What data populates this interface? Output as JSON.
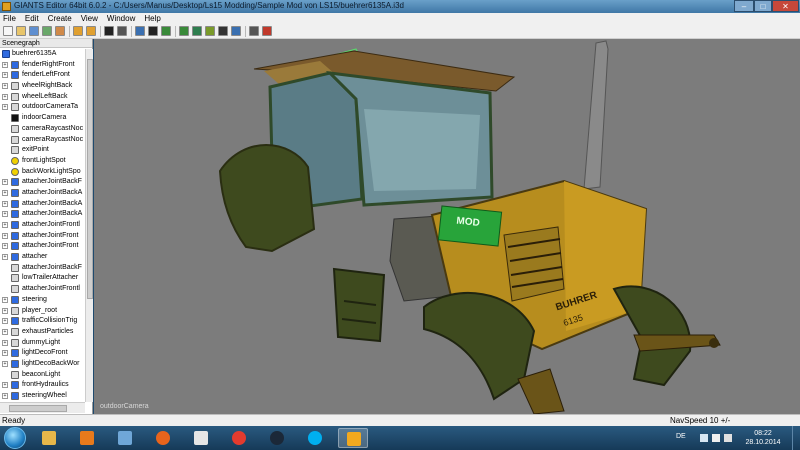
{
  "window": {
    "title": "GIANTS Editor 64bit 6.0.2 - C:/Users/Manus/Desktop/Ls15 Modding/Sample Mod von LS15/buehrer6135A.i3d",
    "minimize": "–",
    "maximize": "□",
    "close": "✕"
  },
  "menu": [
    "File",
    "Edit",
    "Create",
    "View",
    "Window",
    "Help"
  ],
  "toolbar": {
    "icons": [
      "new-icon",
      "open-icon",
      "save-icon",
      "import-icon",
      "export-icon",
      "undo-icon",
      "redo-icon",
      "play-icon",
      "stop-icon",
      "select-icon",
      "translate-icon",
      "rotate-icon",
      "scale-icon",
      "terrain-icon",
      "paint-icon",
      "snap-icon",
      "grid-icon",
      "settings-icon",
      "help-icon"
    ]
  },
  "scenegraph": {
    "header": "Scenegraph",
    "root": "buehrer6135A",
    "nodes": [
      {
        "label": "fenderRightFront",
        "icon": "transform-group-icon",
        "color": "#2f6ae0",
        "expandable": true
      },
      {
        "label": "fenderLeftFront",
        "icon": "transform-group-icon",
        "color": "#2f6ae0",
        "expandable": true
      },
      {
        "label": "wheelRightBack",
        "icon": "transform-icon",
        "color": "#d8d8d8",
        "expandable": true
      },
      {
        "label": "wheelLeftBack",
        "icon": "transform-icon",
        "color": "#d8d8d8",
        "expandable": true
      },
      {
        "label": "outdoorCameraTa",
        "icon": "transform-icon",
        "color": "#d8d8d8",
        "expandable": true
      },
      {
        "label": "indoorCamera",
        "icon": "camera-icon",
        "color": "#111111",
        "expandable": false
      },
      {
        "label": "cameraRaycastNoc",
        "icon": "transform-icon",
        "color": "#d8d8d8",
        "expandable": false
      },
      {
        "label": "cameraRaycastNoc",
        "icon": "transform-icon",
        "color": "#d8d8d8",
        "expandable": false
      },
      {
        "label": "exitPoint",
        "icon": "transform-icon",
        "color": "#d8d8d8",
        "expandable": false
      },
      {
        "label": "frontLightSpot",
        "icon": "light-icon",
        "color": "#f0d000",
        "expandable": false
      },
      {
        "label": "backWorkLightSpo",
        "icon": "light-icon",
        "color": "#f0d000",
        "expandable": false
      },
      {
        "label": "attacherJointBackF",
        "icon": "transform-group-icon",
        "color": "#2f6ae0",
        "expandable": true
      },
      {
        "label": "attacherJointBackA",
        "icon": "transform-group-icon",
        "color": "#2f6ae0",
        "expandable": true
      },
      {
        "label": "attacherJointBackA",
        "icon": "transform-group-icon",
        "color": "#2f6ae0",
        "expandable": true
      },
      {
        "label": "attacherJointBackA",
        "icon": "transform-group-icon",
        "color": "#2f6ae0",
        "expandable": true
      },
      {
        "label": "attacherJointFrontl",
        "icon": "transform-group-icon",
        "color": "#2f6ae0",
        "expandable": true
      },
      {
        "label": "attacherJointFront",
        "icon": "transform-group-icon",
        "color": "#2f6ae0",
        "expandable": true
      },
      {
        "label": "attacherJointFront",
        "icon": "transform-group-icon",
        "color": "#2f6ae0",
        "expandable": true
      },
      {
        "label": "attacher",
        "icon": "transform-group-icon",
        "color": "#2f6ae0",
        "expandable": true
      },
      {
        "label": "attacherJointBackF",
        "icon": "transform-icon",
        "color": "#d8d8d8",
        "expandable": false
      },
      {
        "label": "lowTrailerAttacher",
        "icon": "transform-icon",
        "color": "#d8d8d8",
        "expandable": false
      },
      {
        "label": "attacherJointFrontl",
        "icon": "transform-icon",
        "color": "#d8d8d8",
        "expandable": false
      },
      {
        "label": "steering",
        "icon": "transform-group-icon",
        "color": "#2f6ae0",
        "expandable": true
      },
      {
        "label": "player_root",
        "icon": "transform-icon",
        "color": "#d8d8d8",
        "expandable": true
      },
      {
        "label": "trafficCollisionTrig",
        "icon": "transform-group-icon",
        "color": "#2f6ae0",
        "expandable": true
      },
      {
        "label": "exhaustParticles",
        "icon": "transform-icon",
        "color": "#d8d8d8",
        "expandable": true
      },
      {
        "label": "dummyLight",
        "icon": "transform-icon",
        "color": "#d8d8d8",
        "expandable": true
      },
      {
        "label": "lightDecoFront",
        "icon": "transform-group-icon",
        "color": "#2f6ae0",
        "expandable": true
      },
      {
        "label": "lightDecoBackWor",
        "icon": "transform-group-icon",
        "color": "#2f6ae0",
        "expandable": true
      },
      {
        "label": "beaconLight",
        "icon": "transform-icon",
        "color": "#d8d8d8",
        "expandable": false
      },
      {
        "label": "frontHydraulics",
        "icon": "transform-group-icon",
        "color": "#2f6ae0",
        "expandable": true
      },
      {
        "label": "steeringWheel",
        "icon": "transform-group-icon",
        "color": "#2f6ae0",
        "expandable": true
      }
    ]
  },
  "viewport": {
    "camera_label": "outdoorCamera",
    "decal_brand": "MOD",
    "hood_brand": "BUHRER",
    "model_number": "6135"
  },
  "status": {
    "left": "Ready",
    "navspeed": "NavSpeed 10 +/-"
  },
  "taskbar": {
    "apps": [
      {
        "name": "explorer-icon",
        "color": "#e7b74a"
      },
      {
        "name": "media-player-icon",
        "color": "#e87a1c"
      },
      {
        "name": "control-panel-icon",
        "color": "#6fa7d8"
      },
      {
        "name": "firefox-icon",
        "color": "#e8641c"
      },
      {
        "name": "text-editor-icon",
        "color": "#e6e6e6"
      },
      {
        "name": "chrome-icon",
        "color": "#e33b2e"
      },
      {
        "name": "steam-icon",
        "color": "#1b2838"
      },
      {
        "name": "skype-icon",
        "color": "#00aff0"
      },
      {
        "name": "giants-editor-icon",
        "color": "#f2a91e"
      }
    ],
    "language": "DE",
    "time": "08:22",
    "date": "28.10.2014"
  }
}
